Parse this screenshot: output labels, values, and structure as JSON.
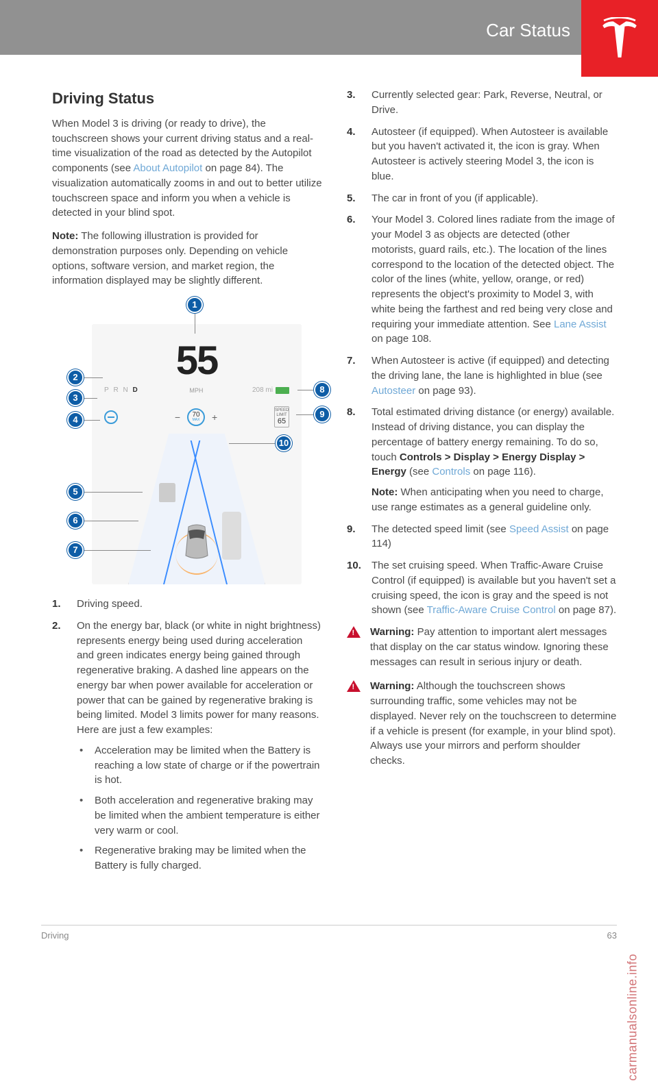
{
  "header": {
    "title": "Car Status"
  },
  "left": {
    "heading": "Driving Status",
    "intro_before_link": "When Model 3 is driving (or ready to drive), the touchscreen shows your current driving status and a real-time visualization of the road as detected by the Autopilot components (see ",
    "intro_link": "About Autopilot",
    "intro_after_link": " on page 84). The visualization automatically zooms in and out to better utilize touchscreen space and inform you when a vehicle is detected in your blind spot.",
    "note_label": "Note:",
    "note_text": " The following illustration is provided for demonstration purposes only. Depending on vehicle options, software version, and market region, the information displayed may be slightly different.",
    "diagram": {
      "speed": "55",
      "gears": {
        "p": "P",
        "r": "R",
        "n": "N",
        "d": "D"
      },
      "mph": "MPH",
      "range": "208 mi",
      "cruise_minus": "−",
      "cruise_plus": "+",
      "cruise_set": "70",
      "cruise_max": "MAX",
      "limit_label": "SPEED\nLIMIT",
      "limit_value": "65",
      "callouts": [
        "1",
        "2",
        "3",
        "4",
        "5",
        "6",
        "7",
        "8",
        "9",
        "10"
      ]
    },
    "items": [
      {
        "text": "Driving speed."
      },
      {
        "text": "On the energy bar, black (or white in night brightness) represents energy being used during acceleration and green indicates energy being gained through regenerative braking. A dashed line appears on the energy bar when power available for acceleration or power that can be gained by regenerative braking is being limited. Model 3 limits power for many reasons. Here are just a few examples:",
        "subs": [
          "Acceleration may be limited when the Battery is reaching a low state of charge or if the powertrain is hot.",
          "Both acceleration and regenerative braking may be limited when the ambient temperature is either very warm or cool.",
          "Regenerative braking may be limited when the Battery is fully charged."
        ]
      }
    ]
  },
  "right": {
    "items": [
      {
        "n": "3",
        "text": "Currently selected gear: Park, Reverse, Neutral, or Drive."
      },
      {
        "n": "4",
        "text": "Autosteer (if equipped). When Autosteer is available but you haven't activated it, the icon is gray. When Autosteer is actively steering Model 3, the icon is blue."
      },
      {
        "n": "5",
        "text": "The car in front of you (if applicable)."
      },
      {
        "n": "6",
        "before": "Your Model 3. Colored lines radiate from the image of your Model 3 as objects are detected (other motorists, guard rails, etc.). The location of the lines correspond to the location of the detected object. The color of the lines (white, yellow, orange, or red) represents the object's proximity to Model 3, with white being the farthest and red being very close and requiring your immediate attention. See ",
        "link": "Lane Assist",
        "after": " on page 108."
      },
      {
        "n": "7",
        "before": "When Autosteer is active (if equipped) and detecting the driving lane, the lane is highlighted in blue (see ",
        "link": "Autosteer",
        "after": " on page 93)."
      },
      {
        "n": "8",
        "before": "Total estimated driving distance (or energy) available. Instead of driving distance, you can display the percentage of battery energy remaining. To do so, touch ",
        "bold": "Controls > Display > Energy Display > Energy",
        "mid": " (see ",
        "link": "Controls",
        "after": " on page 116).",
        "note_label": "Note:",
        "note": " When anticipating when you need to charge, use range estimates as a general guideline only."
      },
      {
        "n": "9",
        "before": "The detected speed limit (see ",
        "link": "Speed Assist",
        "after": " on page 114)"
      },
      {
        "n": "10",
        "before": "The set cruising speed. When Traffic-Aware Cruise Control (if equipped) is available but you haven't set a cruising speed, the icon is gray and the speed is not shown (see ",
        "link": "Traffic-Aware Cruise Control",
        "after": " on page 87)."
      }
    ],
    "warnings": [
      {
        "label": "Warning:",
        "text": " Pay attention to important alert messages that display on the car status window. Ignoring these messages can result in serious injury or death."
      },
      {
        "label": "Warning:",
        "text": " Although the touchscreen shows surrounding traffic, some vehicles may not be displayed. Never rely on the touchscreen to determine if a vehicle is present (for example, in your blind spot). Always use your mirrors and perform shoulder checks."
      }
    ]
  },
  "footer": {
    "left": "Driving",
    "right": "63"
  },
  "watermark": "carmanualsonline.info"
}
